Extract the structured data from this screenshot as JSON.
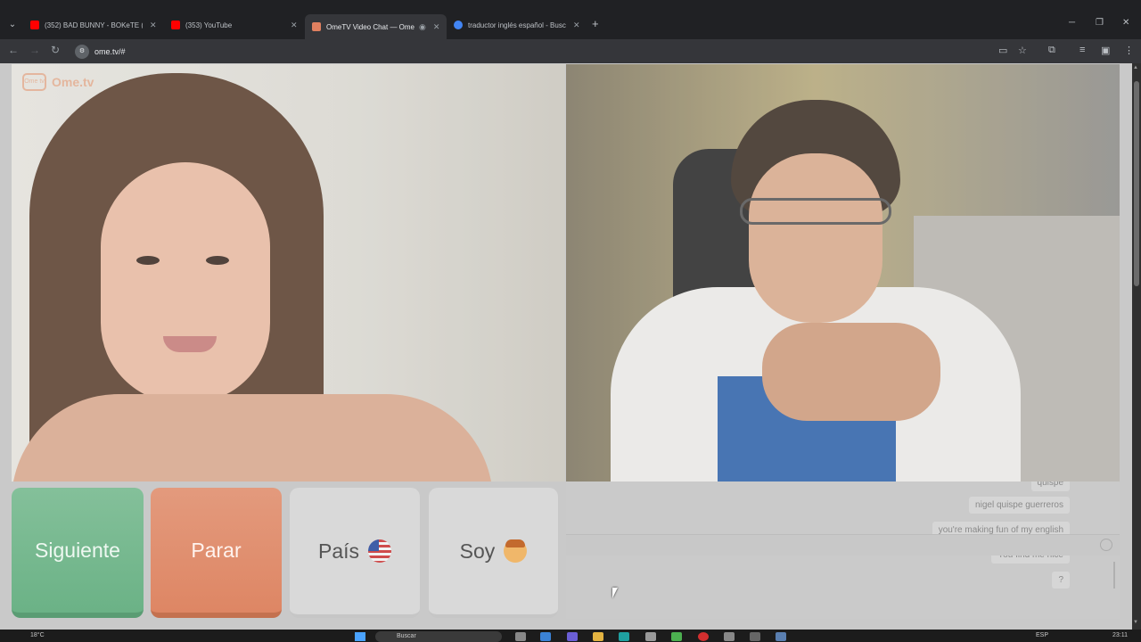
{
  "browser": {
    "tabs": [
      {
        "title": "(352) BAD BUNNY - BOKeTE (V",
        "favicon_color": "#ff0000",
        "active": false
      },
      {
        "title": "(353) YouTube",
        "favicon_color": "#ff0000",
        "active": false
      },
      {
        "title": "OmeTV Video Chat — Ome",
        "favicon_color": "#e08060",
        "active": true
      },
      {
        "title": "traductor inglés español - Busc",
        "favicon_color": "#4285f4",
        "active": false
      }
    ],
    "url": "ome.tv/#"
  },
  "app": {
    "logo_text": "Ome.tv",
    "logo_badge": "Ome tv",
    "accent_color": "#e4936a"
  },
  "controls": {
    "next_label": "Siguiente",
    "stop_label": "Parar",
    "country_label": "País",
    "gender_label": "Soy",
    "next_color": "#6bb286",
    "stop_color": "#de8664"
  },
  "chat": {
    "messages": [
      {
        "text": "quispe",
        "partial": true
      },
      {
        "text": "nigel quispe guerreros"
      },
      {
        "text": "you're making fun of my english"
      },
      {
        "text": "You find me nice"
      },
      {
        "text": "?"
      }
    ]
  },
  "taskbar": {
    "weather": "18°C",
    "search_placeholder": "Buscar",
    "language": "ESP",
    "time": "23:11"
  }
}
